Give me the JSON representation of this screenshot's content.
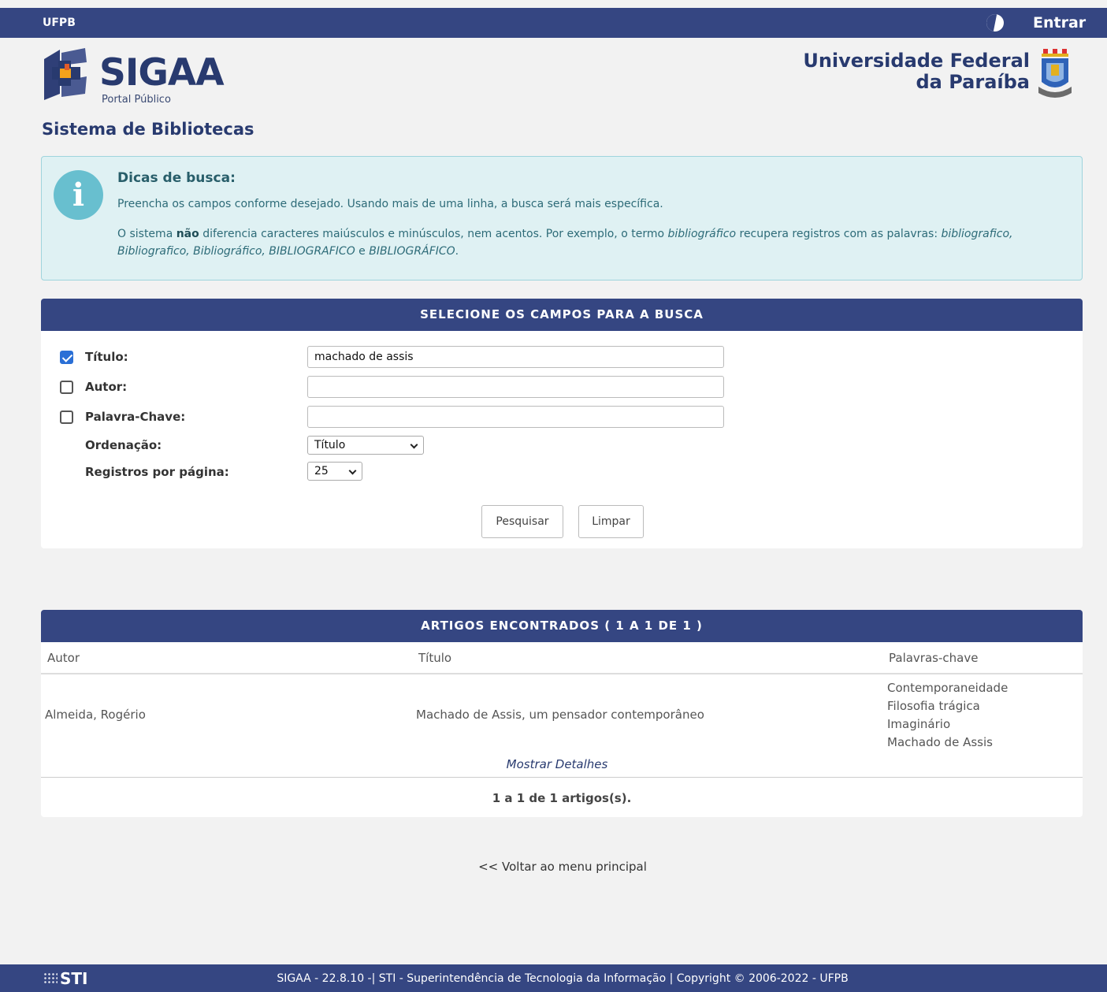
{
  "topbar": {
    "institution": "UFPB",
    "login_label": "Entrar",
    "contrast_icon": "contrast-icon"
  },
  "header": {
    "system_name": "SIGAA",
    "subtitle": "Portal Público",
    "university_line1": "Universidade Federal",
    "university_line2": "da Paraíba"
  },
  "page": {
    "title": "Sistema de Bibliotecas"
  },
  "tips": {
    "title": "Dicas de busca:",
    "line1": "Preencha os campos conforme desejado. Usando mais de uma linha, a busca será mais específica.",
    "line2_a": "O sistema ",
    "line2_bold": "não",
    "line2_b": " diferencia caracteres maiúsculos e minúsculos, nem acentos. Por exemplo, o termo ",
    "line2_term": "bibliográfico",
    "line2_c": " recupera registros com as palavras: ",
    "line2_examples": "bibliografico, Bibliografico, Bibliográfico, BIBLIOGRAFICO",
    "line2_and": " e ",
    "line2_last": "BIBLIOGRÁFICO",
    "line2_end": "."
  },
  "search": {
    "header": "SELECIONE OS CAMPOS PARA A BUSCA",
    "fields": [
      {
        "label": "Título:",
        "checked": true,
        "value": "machado de assis"
      },
      {
        "label": "Autor:",
        "checked": false,
        "value": ""
      },
      {
        "label": "Palavra-Chave:",
        "checked": false,
        "value": ""
      }
    ],
    "ordering_label": "Ordenação:",
    "ordering_value": "Título",
    "per_page_label": "Registros por página:",
    "per_page_value": "25",
    "search_button": "Pesquisar",
    "clear_button": "Limpar"
  },
  "results": {
    "header": "ARTIGOS ENCONTRADOS ( 1 A 1 DE 1 )",
    "columns": [
      "Autor",
      "Título",
      "Palavras-chave"
    ],
    "rows": [
      {
        "author": "Almeida, Rogério",
        "title": "Machado de Assis, um pensador contemporâneo",
        "keywords": [
          "Contemporaneidade",
          "Filosofia trágica",
          "Imaginário",
          "Machado de Assis"
        ],
        "details_link": "Mostrar Detalhes"
      }
    ],
    "count": "1 a 1 de 1 artigos(s)."
  },
  "back_link": "<< Voltar ao menu principal",
  "footer": {
    "logo": "STI",
    "copyright": "SIGAA - 22.8.10 -| STI - Superintendência de Tecnologia da Informação | Copyright © 2006-2022 - UFPB"
  },
  "colors": {
    "navy": "#354682",
    "brand_text": "#283a6f",
    "info_bg": "#dff1f3",
    "info_icon": "#68bfcf",
    "checkbox": "#2a6fd6"
  }
}
